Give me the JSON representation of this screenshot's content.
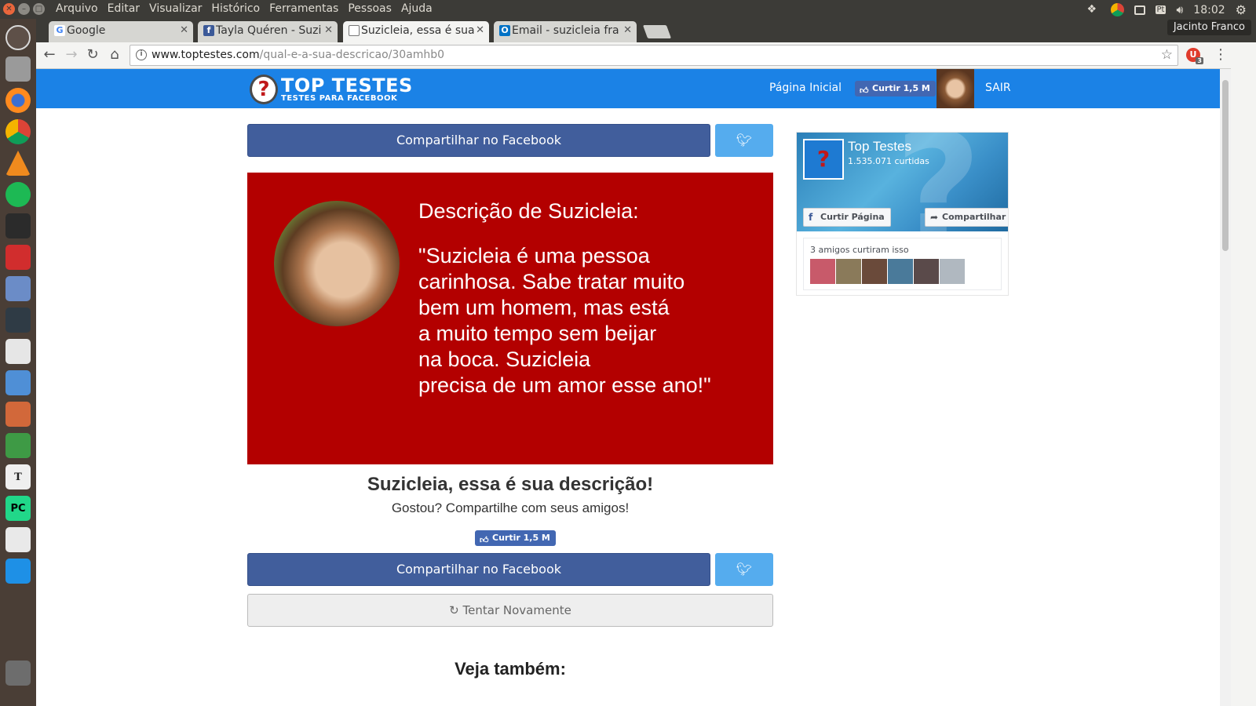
{
  "os": {
    "menu": [
      "Arquivo",
      "Editar",
      "Visualizar",
      "Histórico",
      "Ferramentas",
      "Pessoas",
      "Ajuda"
    ],
    "clock": "18:02",
    "keyboard_layout": "Pt",
    "user": "Jacinto Franco",
    "launcher_icons": [
      "ubuntu-dash-icon",
      "files-icon",
      "firefox-icon",
      "chrome-icon",
      "vlc-icon",
      "spotify-icon",
      "app-icon",
      "mendeley-icon",
      "virtualbox-icon",
      "terminal-icon",
      "text-editor-icon",
      "writer-icon",
      "impress-icon",
      "calc-icon",
      "texmaker-icon",
      "pycharm-icon",
      "document-viewer-icon",
      "folder-icon",
      "trash-icon"
    ]
  },
  "browser": {
    "tabs": [
      {
        "title": "Google",
        "favicon": "google-icon",
        "active": false
      },
      {
        "title": "Tayla Quéren - Suzi",
        "favicon": "facebook-icon",
        "active": false
      },
      {
        "title": "Suzicleia, essa é sua",
        "favicon": "page-icon",
        "active": true
      },
      {
        "title": "Email - suzicleia fra",
        "favicon": "outlook-icon",
        "active": false
      }
    ],
    "url_host": "www.toptestes.com",
    "url_path": "/qual-e-a-sua-descricao/30amhb0",
    "extension_badge": "3"
  },
  "site": {
    "logo_title": "TOP TESTES",
    "logo_subtitle": "TESTES PARA FACEBOOK",
    "nav_home": "Página Inicial",
    "like_label": "Curtir 1,5 M",
    "logout": "SAIR",
    "share_facebook": "Compartilhar no Facebook",
    "result_heading": "Descrição de Suzicleia:",
    "result_quote": "\"Suzicleia é uma pessoa\ncarinhosa. Sabe tratar muito\nbem um homem, mas está\na muito tempo sem beijar\nna boca. Suzicleia\nprecisa de um amor esse ano!\"",
    "result_title": "Suzicleia, essa é sua descrição!",
    "result_subtitle": "Gostou? Compartilhe com seus amigos!",
    "retry": "Tentar Novamente",
    "see_also": "Veja também:",
    "colors": {
      "header": "#1b82e6",
      "card": "#b30000",
      "facebook": "#415e9c",
      "twitter": "#55acee"
    }
  },
  "fb_plugin": {
    "page_name": "Top Testes",
    "page_likes": "1.535.071 curtidas",
    "like_page": "Curtir Página",
    "share": "Compartilhar",
    "friends_text": "3 amigos curtiram isso"
  }
}
